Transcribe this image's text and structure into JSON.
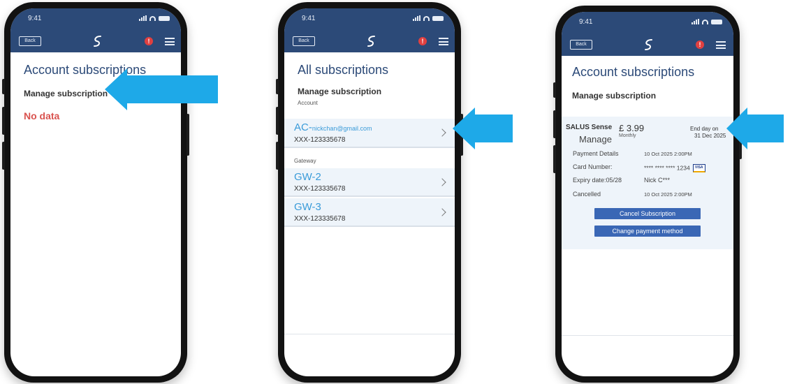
{
  "status": {
    "time": "9:41"
  },
  "nav": {
    "back_label": "Back",
    "alert_label": "!"
  },
  "screen1": {
    "title": "Account subscriptions",
    "manage": "Manage subscription",
    "empty": "No data"
  },
  "screen2": {
    "title": "All subscriptions",
    "manage": "Manage subscription",
    "account_label": "Account",
    "account_item": {
      "prefix": "AC-",
      "email": "nickchan@gmail.com",
      "id": "XXX-123335678"
    },
    "gateway_label": "Gateway",
    "gateways": [
      {
        "name": "GW-2",
        "id": "XXX-123335678"
      },
      {
        "name": "GW-3",
        "id": "XXX-123335678"
      }
    ]
  },
  "screen3": {
    "title": "Account subscriptions",
    "manage": "Manage subscription",
    "plan": "SALUS Sense",
    "manage_link": "Manage",
    "price": "£ 3.99",
    "period": "Monthly",
    "end_label": "End day on",
    "end_date": "31 Dec 2025",
    "details": [
      {
        "label": "Payment Details",
        "value": "10 Oct 2025 2:00PM"
      },
      {
        "label": "Card Number:",
        "value": "**** **** **** 1234"
      },
      {
        "label": "Expiry date:05/28",
        "value": "Nick C***"
      },
      {
        "label": "Cancelled",
        "value": "10 Oct 2025 2:00PM"
      }
    ],
    "card_brand": "VISA",
    "cancel_button": "Cancel Subscription",
    "change_button": "Change payment method"
  },
  "colors": {
    "header": "#2c4a78",
    "arrow": "#1ea9e8",
    "accent": "#3a9bd9",
    "error": "#d9534f",
    "button": "#3a67b5"
  }
}
